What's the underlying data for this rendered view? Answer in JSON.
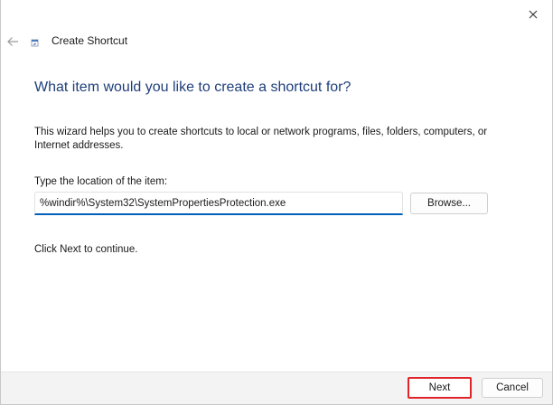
{
  "window": {
    "title": "Create Shortcut",
    "close_icon": "close-icon",
    "back_icon": "back-arrow-icon",
    "app_icon": "shortcut-icon"
  },
  "main": {
    "heading": "What item would you like to create a shortcut for?",
    "description": "This wizard helps you to create shortcuts to local or network programs, files, folders, computers, or Internet addresses.",
    "location_label": "Type the location of the item:",
    "location_value": "%windir%\\System32\\SystemPropertiesProtection.exe",
    "browse_label": "Browse...",
    "continue_text": "Click Next to continue."
  },
  "footer": {
    "next_label": "Next",
    "cancel_label": "Cancel"
  },
  "colors": {
    "heading": "#1f3f7a",
    "input_focus": "#005fb8",
    "highlight": "#e0242a"
  }
}
